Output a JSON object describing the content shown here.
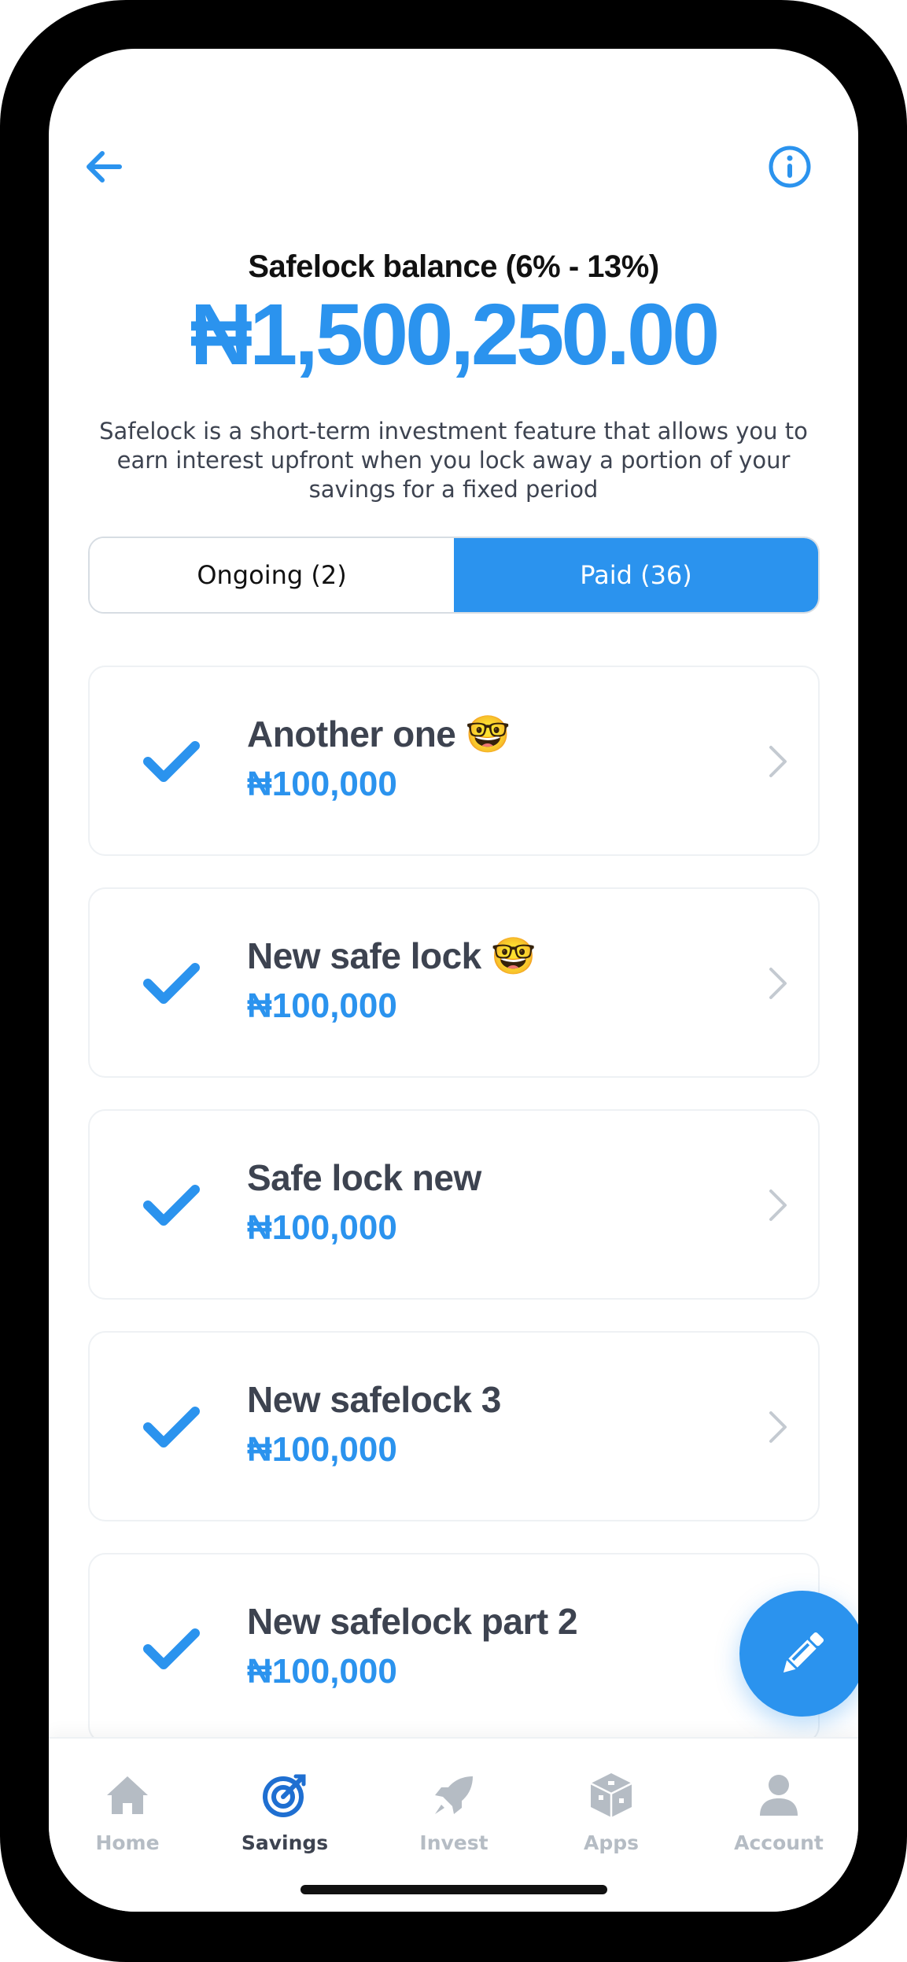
{
  "header": {
    "back_icon": "arrow-left-icon",
    "info_icon": "info-circle-icon",
    "balance_label": "Safelock balance (6% - 13%)",
    "balance_amount": "₦1,500,250.00",
    "description": "Safelock is a short-term investment feature that allows you to earn interest upfront when you lock away a portion of your savings for a fixed period"
  },
  "tabs": [
    {
      "label": "Ongoing (2)",
      "active": false
    },
    {
      "label": "Paid (36)",
      "active": true
    }
  ],
  "safelocks": [
    {
      "title": "Another one 🤓",
      "amount": "₦100,000",
      "status_icon": "check-icon"
    },
    {
      "title": "New safe lock 🤓",
      "amount": "₦100,000",
      "status_icon": "check-icon"
    },
    {
      "title": "Safe lock new",
      "amount": "₦100,000",
      "status_icon": "check-icon"
    },
    {
      "title": "New safelock 3",
      "amount": "₦100,000",
      "status_icon": "check-icon"
    },
    {
      "title": "New safelock part 2",
      "amount": "₦100,000",
      "status_icon": "check-icon"
    }
  ],
  "fab_icon": "pencil-icon",
  "bottom_nav": [
    {
      "label": "Home",
      "icon": "home-icon",
      "active": false
    },
    {
      "label": "Savings",
      "icon": "target-icon",
      "active": true
    },
    {
      "label": "Invest",
      "icon": "rocket-icon",
      "active": false
    },
    {
      "label": "Apps",
      "icon": "cube-icon",
      "active": false
    },
    {
      "label": "Account",
      "icon": "person-icon",
      "active": false
    }
  ],
  "colors": {
    "accent": "#2b93ee",
    "text_dark": "#3d4350",
    "inactive": "#b5bcc4"
  }
}
